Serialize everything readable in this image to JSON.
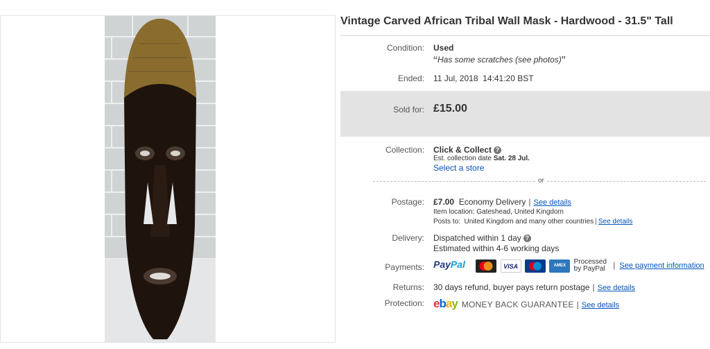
{
  "listing": {
    "title": "Vintage Carved African Tribal Wall Mask - Hardwood - 31.5\" Tall"
  },
  "condition": {
    "label": "Condition:",
    "value": "Used",
    "note": "Has some scratches (see photos)"
  },
  "ended": {
    "label": "Ended:",
    "date": "11 Jul, 2018",
    "time": "14:41:20 BST"
  },
  "sold": {
    "label": "Sold for:",
    "price": "£15.00"
  },
  "collection": {
    "label": "Collection:",
    "method": "Click & Collect",
    "est_prefix": "Est. collection date",
    "est_date": "Sat. 28 Jul.",
    "store_link": "Select a store"
  },
  "divider": {
    "or": "or"
  },
  "postage": {
    "label": "Postage:",
    "price": "£7.00",
    "service": "Economy Delivery",
    "see_details": "See details",
    "item_location": "Item location:  Gateshead, United Kingdom",
    "posts_to_label": "Posts to:",
    "posts_to": "United Kingdom and many other countries",
    "see_details_2": "See details"
  },
  "delivery": {
    "label": "Delivery:",
    "dispatch": "Dispatched within 1 day",
    "estimate": "Estimated within 4-6 working days"
  },
  "payments": {
    "label": "Payments:",
    "paypal_a": "Pay",
    "paypal_b": "Pal",
    "cards": [
      "MasterCard",
      "VISA",
      "Maestro",
      "AMEX"
    ],
    "processed_1": "Processed",
    "processed_2": "by PayPal",
    "see_info": "See payment information"
  },
  "returns": {
    "label": "Returns:",
    "text": "30 days refund, buyer pays return postage",
    "see_details": "See details"
  },
  "protection": {
    "label": "Protection:",
    "logo": [
      "e",
      "b",
      "a",
      "y"
    ],
    "guarantee": "MONEY BACK GUARANTEE",
    "see_details": "See details"
  },
  "colors": {
    "link": "#0654ba",
    "sold_bg": "#e3e3e3",
    "mask": "#1f130d",
    "gold": "#8a6d2e"
  }
}
